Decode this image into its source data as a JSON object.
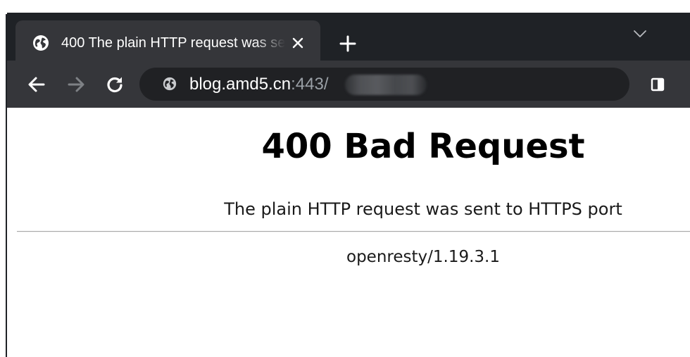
{
  "colors": {
    "frame": "#1f2226",
    "toolbar": "#35363a",
    "omnibox": "#202124",
    "url_muted": "#9aa0a6",
    "page_background": "#ffffff"
  },
  "tab": {
    "title": "400 The plain HTTP request was sent to HTTPS port",
    "favicon": "globe-icon",
    "close_icon": "close-icon"
  },
  "tabstrip": {
    "new_tab_icon": "plus-icon",
    "search_tabs_icon": "chevron-down-icon"
  },
  "toolbar": {
    "back_icon": "arrow-left-icon",
    "forward_icon": "arrow-right-icon",
    "reload_icon": "reload-icon",
    "sidepanel_icon": "side-panel-icon"
  },
  "address_bar": {
    "site_icon": "globe-icon",
    "host": "blog.amd5.cn",
    "port": ":443",
    "path": "/"
  },
  "page": {
    "heading": "400 Bad Request",
    "message": "The plain HTTP request was sent to HTTPS port",
    "server": "openresty/1.19.3.1"
  }
}
